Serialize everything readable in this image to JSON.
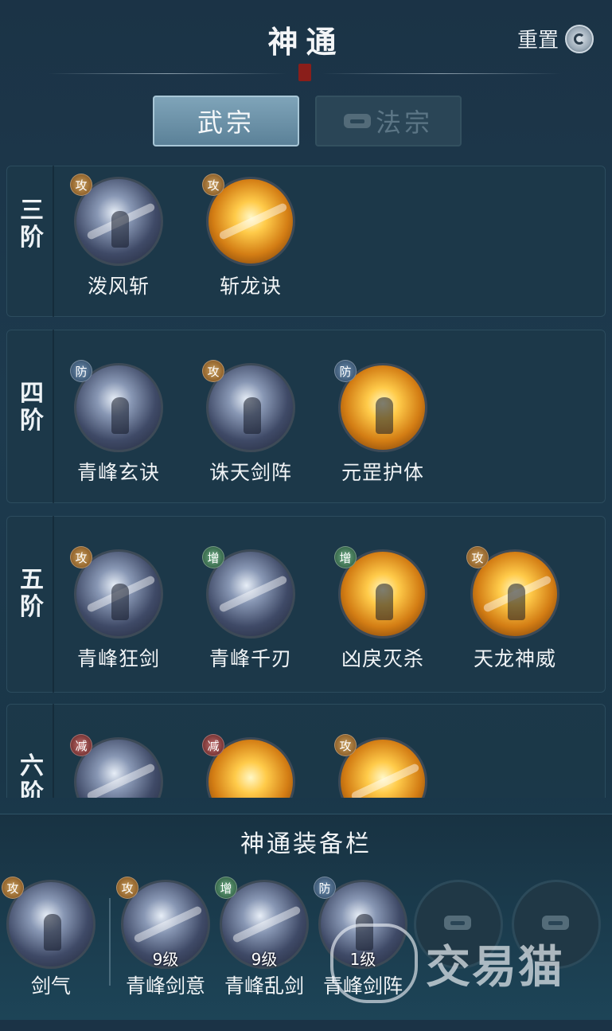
{
  "header": {
    "title": "神通",
    "reset_label": "重置",
    "reset_icon": "refresh-swirl-icon"
  },
  "tabs": [
    {
      "label": "武宗",
      "active": true
    },
    {
      "label": "法宗",
      "active": false,
      "locked": true
    }
  ],
  "tiers": [
    {
      "label": [
        "三",
        "阶"
      ],
      "skills": [
        {
          "name": "泼风斩",
          "tag": "攻",
          "style": "blue"
        },
        {
          "name": "斩龙诀",
          "tag": "攻",
          "style": "gold"
        }
      ]
    },
    {
      "label": [
        "四",
        "阶"
      ],
      "skills": [
        {
          "name": "青峰玄诀",
          "tag": "防",
          "style": "blue"
        },
        {
          "name": "诛天剑阵",
          "tag": "攻",
          "style": "blue"
        },
        {
          "name": "元罡护体",
          "tag": "防",
          "style": "gold"
        }
      ]
    },
    {
      "label": [
        "五",
        "阶"
      ],
      "skills": [
        {
          "name": "青峰狂剑",
          "tag": "攻",
          "style": "blue"
        },
        {
          "name": "青峰千刃",
          "tag": "增",
          "style": "blue"
        },
        {
          "name": "凶戾灭杀",
          "tag": "增",
          "style": "gold"
        },
        {
          "name": "天龙神威",
          "tag": "攻",
          "style": "gold"
        }
      ]
    },
    {
      "label": [
        "六",
        "阶"
      ],
      "skills": [
        {
          "tag": "减",
          "style": "blue"
        },
        {
          "tag": "减",
          "style": "gold"
        },
        {
          "tag": "攻",
          "style": "gold"
        }
      ]
    }
  ],
  "equip": {
    "title": "神通装备栏",
    "slots": [
      {
        "name": "剑气",
        "tag": "攻",
        "level": "",
        "style": "blue"
      },
      {
        "name": "青峰剑意",
        "tag": "攻",
        "level": "9级",
        "style": "blue"
      },
      {
        "name": "青峰乱剑",
        "tag": "增",
        "level": "9级",
        "style": "blue"
      },
      {
        "name": "青峰剑阵",
        "tag": "防",
        "level": "1级",
        "style": "blue"
      }
    ],
    "empty_slots": 2
  },
  "watermark": {
    "text": "交易猫"
  },
  "colors": {
    "attack": "#7a4a16",
    "defense": "#2b4560",
    "buff": "#244f35",
    "debuff": "#5e1e1e",
    "active_tab": "#6a90a6"
  }
}
